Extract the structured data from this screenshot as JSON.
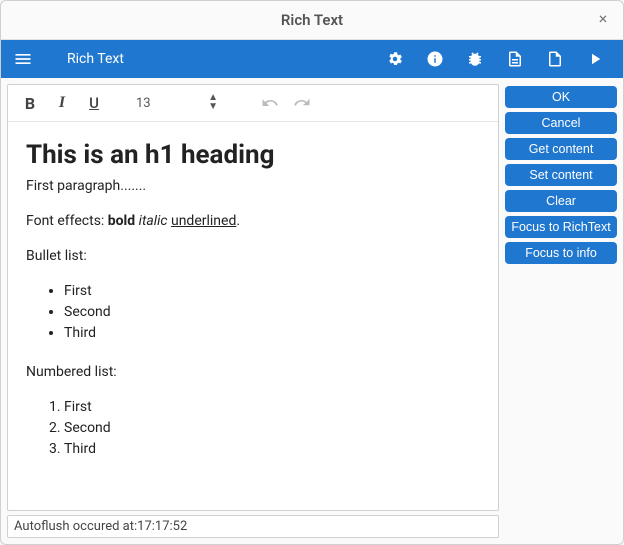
{
  "window": {
    "title": "Rich Text"
  },
  "appbar": {
    "title": "Rich Text"
  },
  "toolbar": {
    "bold_label": "B",
    "italic_label": "I",
    "underline_label": "U",
    "font_size": "13"
  },
  "content": {
    "heading": "This is an h1 heading",
    "para1": "First paragraph.......",
    "effects_prefix": "Font effects: ",
    "bold_word": "bold",
    "italic_word": "italic",
    "underlined_word": "underlined",
    "effects_suffix": ".",
    "bullet_label": "Bullet list:",
    "bullets": [
      "First",
      "Second",
      "Third"
    ],
    "numbered_label": "Numbered list:",
    "numbered": [
      "First",
      "Second",
      "Third"
    ]
  },
  "buttons": {
    "ok": "OK",
    "cancel": "Cancel",
    "get_content": "Get content",
    "set_content": "Set content",
    "clear": "Clear",
    "focus_rich": "Focus to RichText",
    "focus_info": "Focus to info"
  },
  "status": {
    "text": "Autoflush occured at:17:17:52"
  }
}
